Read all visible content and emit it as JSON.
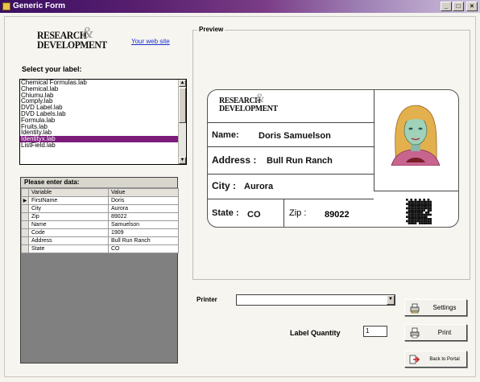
{
  "window": {
    "title": "Generic Form",
    "min": "_",
    "max": "□",
    "close": "×"
  },
  "branding": {
    "logo_line1": "RESEARCH",
    "logo_line2": "DEVELOPMENT",
    "website_link": "Your web site"
  },
  "label_selector": {
    "heading": "Select your label:",
    "items": [
      "Chemical Formulas.lab",
      "Chemical.lab",
      "Chiumu.lab",
      "Comply.lab",
      "DVD Label.lab",
      "DVD Labels.lab",
      "Formula.lab",
      "Fruits.lab",
      "Identity.lab",
      "Identityx.lab",
      "ListField.lab"
    ],
    "selected_index": 9
  },
  "data_grid": {
    "caption": "Please enter data:",
    "columns": [
      "Variable",
      "Value"
    ],
    "rows": [
      {
        "variable": "FirstName",
        "value": "Doris",
        "current": true
      },
      {
        "variable": "City",
        "value": "Aurora"
      },
      {
        "variable": "Zip",
        "value": "89022"
      },
      {
        "variable": "Name",
        "value": "Samuelson"
      },
      {
        "variable": "Code",
        "value": "1909"
      },
      {
        "variable": "Address",
        "value": "Bull Run Ranch"
      },
      {
        "variable": "State",
        "value": "CO"
      }
    ]
  },
  "preview": {
    "legend": "Preview",
    "card": {
      "name_label": "Name:",
      "name_value": "Doris Samuelson",
      "address_label": "Address :",
      "address_value": "Bull Run Ranch",
      "city_label": "City :",
      "city_value": "Aurora",
      "state_label": "State :",
      "state_value": "CO",
      "zip_label": "Zip :",
      "zip_value": "89022"
    }
  },
  "controls": {
    "printer_label": "Printer",
    "printer_value": "",
    "settings_button": "Settings",
    "print_button": "Print",
    "portal_button": "Back to Portal",
    "quantity_label": "Label Quantity",
    "quantity_value": "1"
  },
  "colors": {
    "selection": "#7b1c7b",
    "title_bar_start": "#3a0e62",
    "link": "#1a2fd0"
  },
  "icons": {
    "app": "form-icon",
    "settings": "printer-settings-icon",
    "print": "print-icon",
    "portal": "exit-arrow-icon"
  }
}
